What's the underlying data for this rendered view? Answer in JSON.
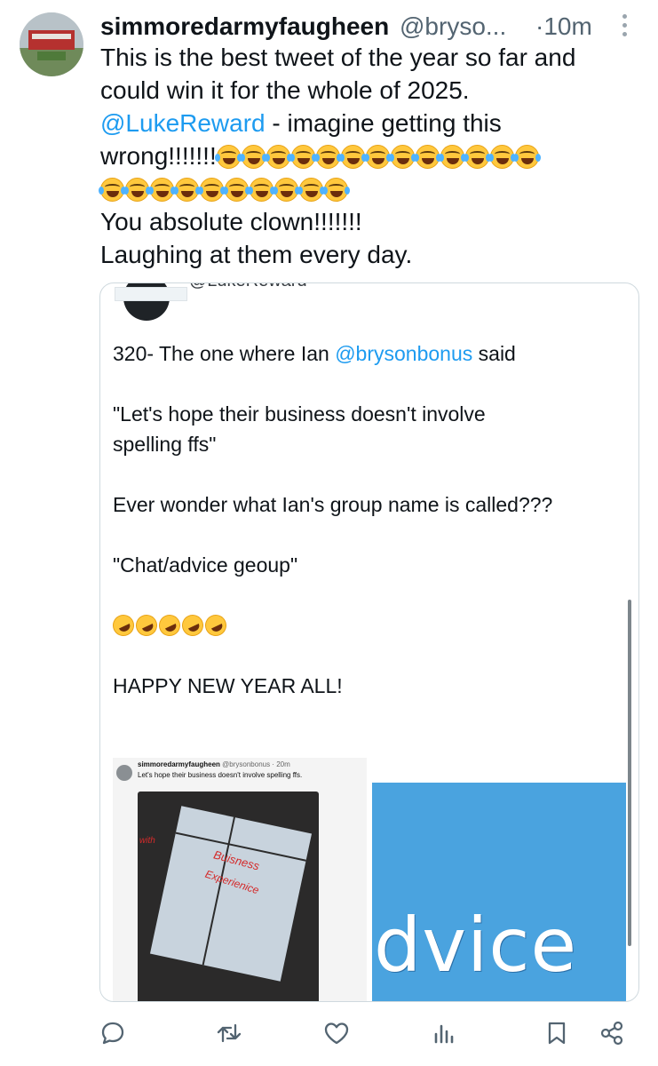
{
  "tweet": {
    "display_name": "simmoredarmyfaugheen",
    "handle": "@bryso...",
    "time": "·10m",
    "lines": [
      "This is the best tweet of the year so far and",
      "could win it for the whole of 2025."
    ],
    "mention": "@LukeReward",
    "mention_suffix": " - imagine getting this",
    "wrong_text": "wrong!!!!!!!",
    "emoji_name": "face-with-tears-of-joy",
    "line_absolute": "You absolute clown!!!!!!!",
    "line_laughing": "Laughing at them every day."
  },
  "quoted": {
    "handle": "@LukeReward",
    "line1_prefix": "320- The one where Ian ",
    "line1_mention": "@brysonbonus",
    "line1_suffix": " said",
    "quote_a": "\"Let's hope their business doesn't involve",
    "quote_b": "spelling ffs\"",
    "wonder": "Ever wonder what Ian's group name is called???",
    "chat": "\"Chat/advice geoup\"",
    "rofl_emoji": "rolling-on-the-floor-laughing",
    "happy": "HAPPY NEW YEAR ALL!",
    "screenshot": {
      "name": "simmoredarmyfaugheen",
      "handle_time": "@brysonbonus · 20m",
      "text": "Let's hope their business doesn't involve spelling ffs.",
      "hand_1": "Buisness",
      "hand_2": "Experienice",
      "hand_3": "with"
    },
    "zoom_word": "dvice"
  },
  "actions": [
    "reply-icon",
    "retweet-icon",
    "like-icon",
    "views-icon",
    "bookmark-icon",
    "share-icon"
  ]
}
